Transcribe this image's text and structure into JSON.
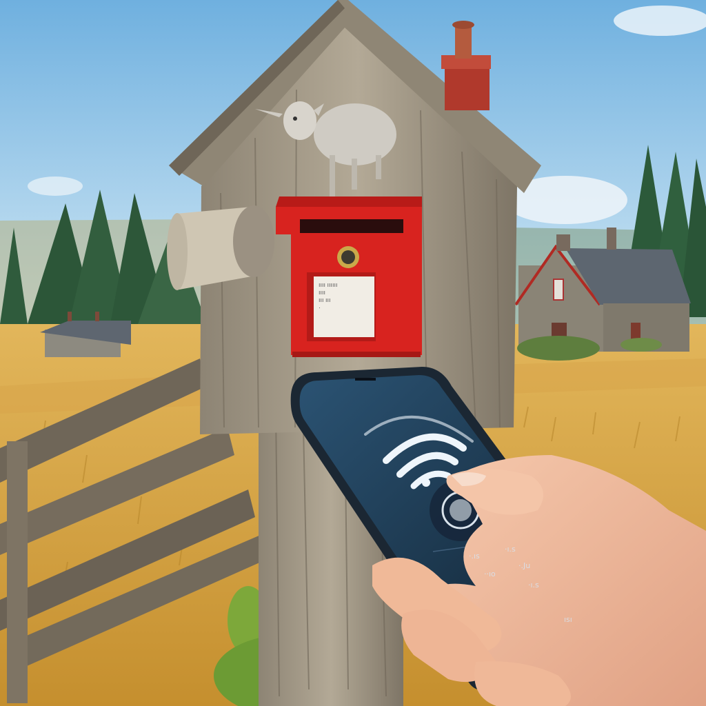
{
  "scene": {
    "description_labels": [],
    "colors": {
      "sky_top": "#7fb7e2",
      "sky_bottom": "#cfe6f4",
      "field": "#d9a94a",
      "field_dark": "#b98a33",
      "wood": "#a39887",
      "wood_dark": "#6f6658",
      "mailbox_red": "#d8231f",
      "roof_red": "#b02a23",
      "phone_body": "#1b2733",
      "phone_screen": "#22435f",
      "skin": "#f2bfa0",
      "tree": "#2f5b3c",
      "moss": "#7da83a"
    }
  },
  "phone": {
    "screen_rows": [
      {
        "left": "·.ıs",
        "right": "·ı.s"
      },
      {
        "left": "··ıo",
        "right": "·.Ju"
      },
      {
        "left": "",
        "right": "·ı.s"
      }
    ],
    "button_label": "ısı",
    "icon": "contactless-wave-icon"
  },
  "mailbox": {
    "card_lines": [
      "ıııı ıııııı",
      "ıııı",
      "ııı ııı",
      "·"
    ]
  }
}
